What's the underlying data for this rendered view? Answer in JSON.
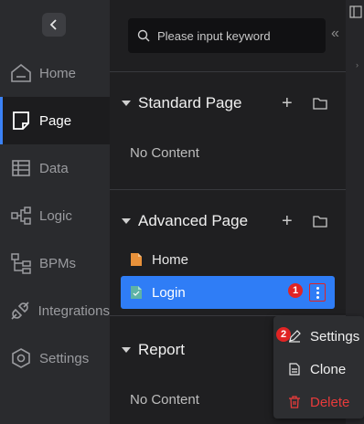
{
  "rail": {
    "items": [
      {
        "label": "Home",
        "icon": "home-icon"
      },
      {
        "label": "Page",
        "icon": "page-icon",
        "active": true
      },
      {
        "label": "Data",
        "icon": "table-icon"
      },
      {
        "label": "Logic",
        "icon": "logic-icon"
      },
      {
        "label": "BPMs",
        "icon": "bpm-icon"
      },
      {
        "label": "Integrations",
        "icon": "plug-icon"
      },
      {
        "label": "Settings",
        "icon": "settings-icon"
      }
    ]
  },
  "panel": {
    "search_placeholder": "Please input keyword",
    "sections": [
      {
        "title": "Standard Page",
        "empty_text": "No Content"
      },
      {
        "title": "Advanced Page",
        "pages": [
          {
            "label": "Home"
          },
          {
            "label": "Login",
            "selected": true
          }
        ]
      },
      {
        "title": "Report",
        "empty_text": "No Content"
      }
    ],
    "badges": {
      "more": "1",
      "settings": "2"
    }
  },
  "context_menu": {
    "items": [
      {
        "label": "Settings",
        "icon": "edit-icon"
      },
      {
        "label": "Clone",
        "icon": "document-icon"
      },
      {
        "label": "Delete",
        "icon": "trash-icon",
        "color": "#e83b3b"
      }
    ]
  },
  "colors": {
    "accent": "#2f7df6",
    "danger": "#e02424"
  }
}
